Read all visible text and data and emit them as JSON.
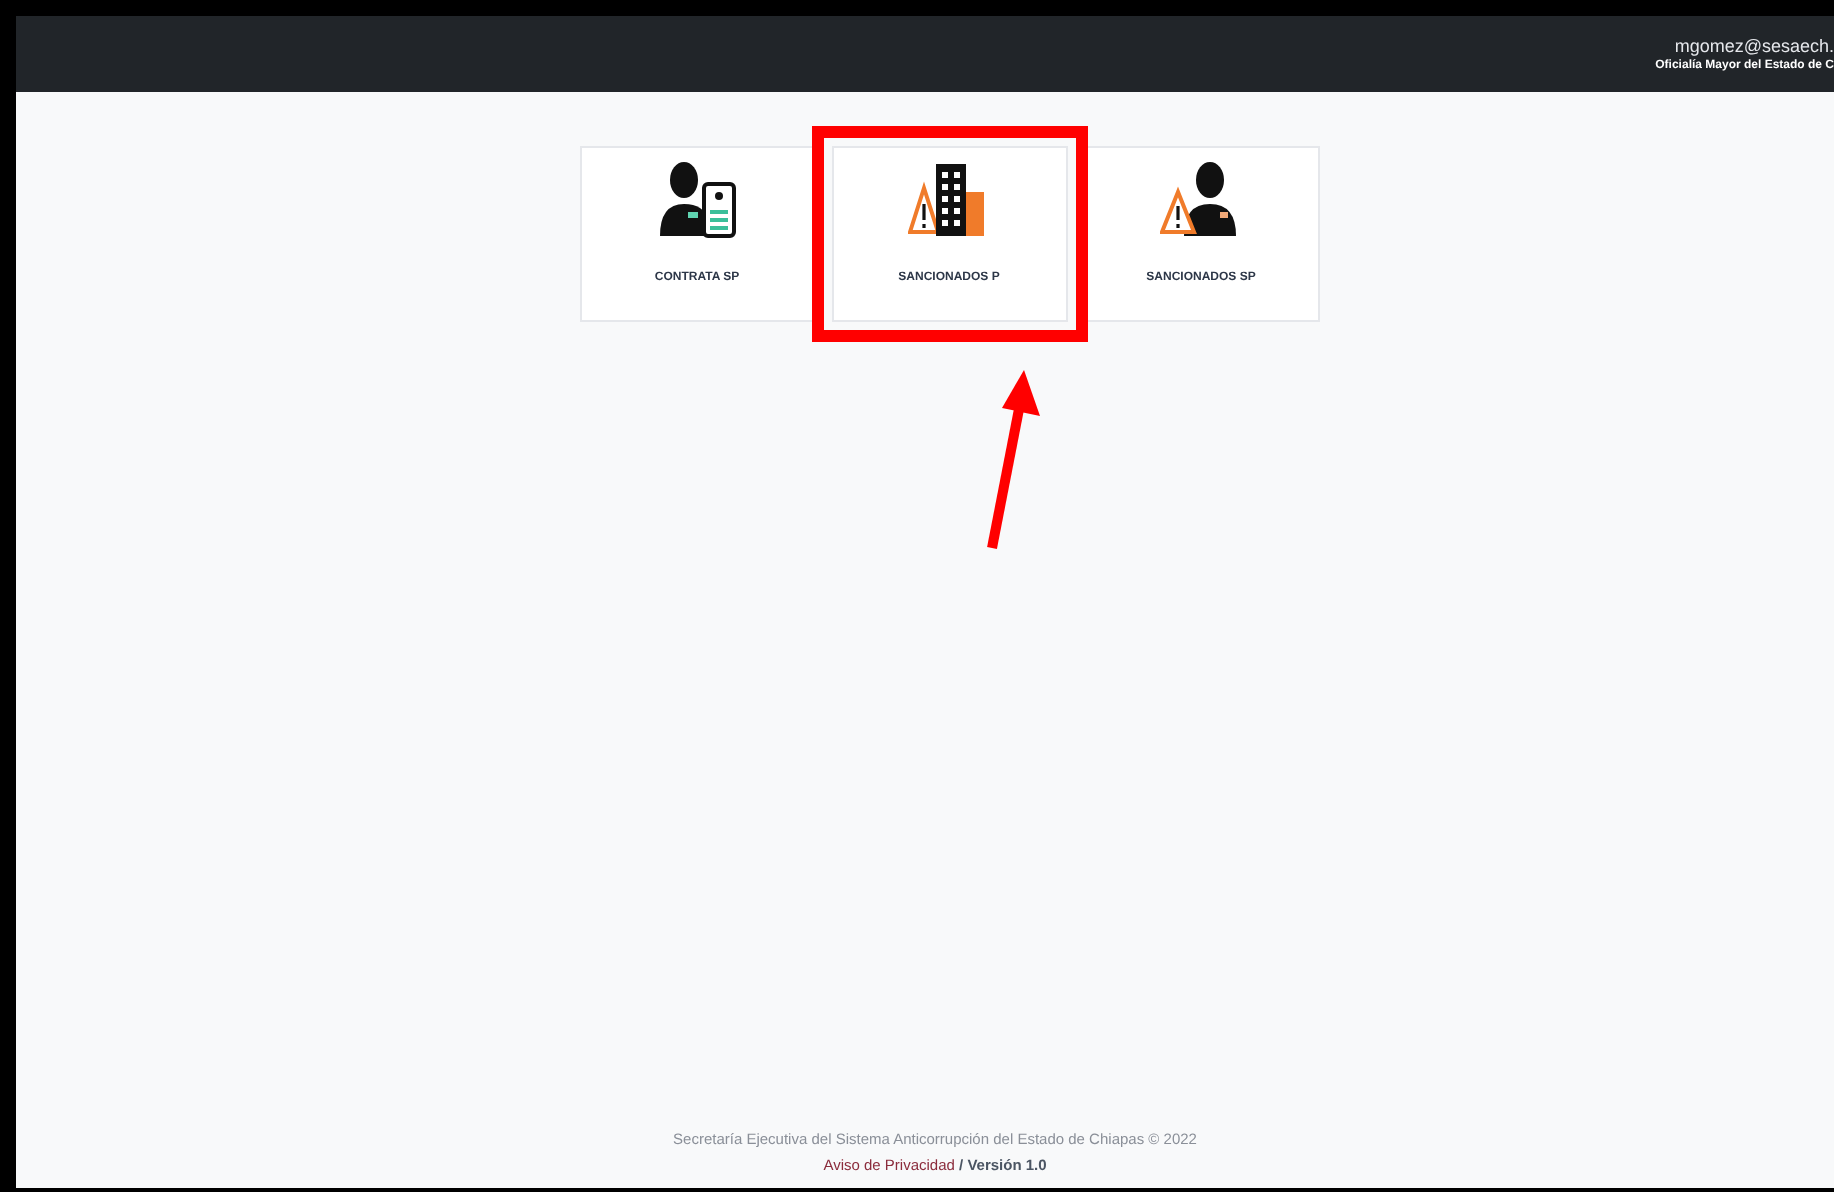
{
  "header": {
    "user_email": "mgomez@sesaech.",
    "organization": "Oficialía Mayor del Estado de C"
  },
  "cards": [
    {
      "kind": "contract",
      "label": "CONTRATA SP",
      "highlighted": false
    },
    {
      "kind": "building",
      "label": "SANCIONADOS P",
      "highlighted": true
    },
    {
      "kind": "person",
      "label": "SANCIONADOS SP",
      "highlighted": false
    }
  ],
  "footer": {
    "copyright": "Secretaría Ejecutiva del Sistema Anticorrupción del Estado de Chiapas © 2022",
    "privacy_link": "Aviso de Privacidad",
    "separator": " / ",
    "version": "Versión 1.0"
  }
}
